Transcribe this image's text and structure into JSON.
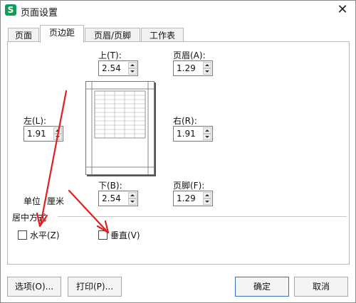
{
  "window": {
    "title": "页面设置",
    "app_icon_letter": "S",
    "close_glyph": "✕"
  },
  "tabs": [
    {
      "label": "页面",
      "active": false
    },
    {
      "label": "页边距",
      "active": true
    },
    {
      "label": "页眉/页脚",
      "active": false
    },
    {
      "label": "工作表",
      "active": false
    }
  ],
  "margins": {
    "top": {
      "label": "上(T):",
      "value": "2.54"
    },
    "header": {
      "label": "页眉(A):",
      "value": "1.29"
    },
    "left": {
      "label": "左(L):",
      "value": "1.91"
    },
    "right": {
      "label": "右(R):",
      "value": "1.91"
    },
    "bottom": {
      "label": "下(B):",
      "value": "2.54"
    },
    "footer": {
      "label": "页脚(F):",
      "value": "1.29"
    }
  },
  "unit": {
    "label": "单位",
    "value": "厘米"
  },
  "center": {
    "section_label": "居中方式",
    "horizontal": {
      "label": "水平(Z)",
      "checked": false
    },
    "vertical": {
      "label": "垂直(V)",
      "checked": false
    }
  },
  "buttons": {
    "options": "选项(O)...",
    "print": "打印(P)...",
    "ok": "确定",
    "cancel": "取消"
  },
  "colors": {
    "annotation_arrow": "#e02020",
    "app_icon": "#0f9d58",
    "primary_border": "#3a6fc4"
  }
}
